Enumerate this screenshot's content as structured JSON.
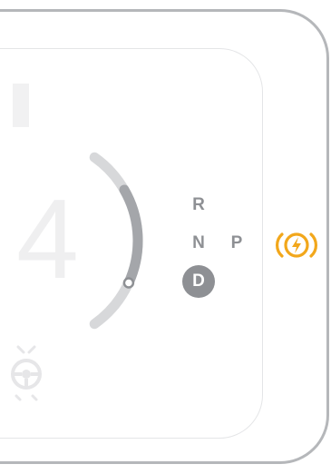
{
  "dashboard": {
    "speed_value": "4",
    "gear_selector": {
      "reverse": "R",
      "neutral": "N",
      "park": "P",
      "drive": "D",
      "active": "drive"
    },
    "power_meter": {
      "level": 0.42
    },
    "indicators": {
      "ready": {
        "icon": "power-ready-icon",
        "color": "#f2a71b"
      },
      "driver_assist": {
        "icon": "steering-assist-icon",
        "color": "#e6e6e8"
      }
    }
  },
  "colors": {
    "gauge_track": "#d7d8da",
    "gauge_fill": "#a4a6aa",
    "gear_text": "#8e9094",
    "gear_active_bg": "#8e9094",
    "ready_amber": "#f2a71b"
  }
}
